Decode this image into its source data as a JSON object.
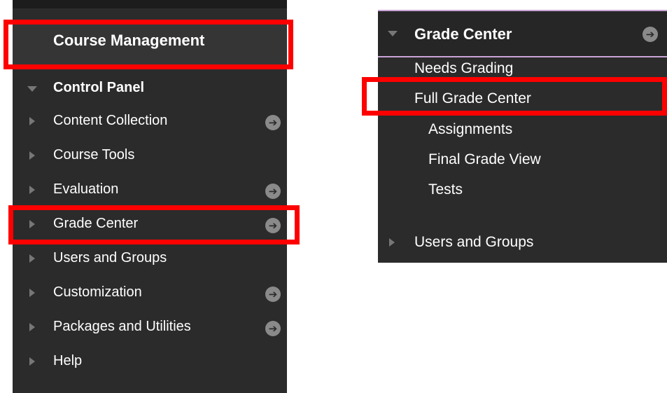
{
  "left_panel": {
    "header": "Course Management",
    "control_panel": "Control Panel",
    "items": [
      {
        "label": "Content Collection",
        "arrow": true
      },
      {
        "label": "Course Tools",
        "arrow": false
      },
      {
        "label": "Evaluation",
        "arrow": true
      },
      {
        "label": "Grade Center",
        "arrow": true
      },
      {
        "label": "Users and Groups",
        "arrow": false
      },
      {
        "label": "Customization",
        "arrow": true
      },
      {
        "label": "Packages and Utilities",
        "arrow": true
      },
      {
        "label": "Help",
        "arrow": false
      }
    ]
  },
  "right_panel": {
    "header": "Grade Center",
    "items": [
      "Needs Grading",
      "Full Grade Center",
      "Assignments",
      "Final Grade View",
      "Tests"
    ],
    "footer_item": "Users and Groups"
  },
  "icons": {
    "arrow_glyph": "➔"
  },
  "colors": {
    "panel_bg": "#2b2b2b",
    "highlight_box": "#ff0000",
    "header_border": "#c9a3d6"
  }
}
